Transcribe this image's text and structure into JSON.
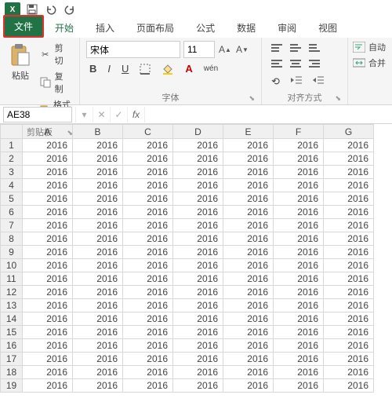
{
  "titlebar": {
    "app": "X",
    "qat": {
      "save": "",
      "undo": "",
      "redo": ""
    }
  },
  "tabs": {
    "file": "文件",
    "items": [
      "开始",
      "插入",
      "页面布局",
      "公式",
      "数据",
      "审阅",
      "视图"
    ],
    "activeIndex": 0
  },
  "ribbon": {
    "clipboard": {
      "label": "剪贴板",
      "paste": "粘贴",
      "cut": "剪切",
      "copy": "复制",
      "format_painter": "格式刷"
    },
    "font": {
      "label": "字体",
      "name": "宋体",
      "size": "11",
      "bold": "B",
      "italic": "I",
      "underline": "U",
      "wen": "wén"
    },
    "alignment": {
      "label": "对齐方式"
    },
    "extra": {
      "wrap": "自动",
      "merge": "合并"
    }
  },
  "formula_bar": {
    "namebox": "AE38",
    "cancel": "✕",
    "enter": "✓",
    "fx": "fx",
    "value": ""
  },
  "sheet": {
    "columns": [
      "A",
      "B",
      "C",
      "D",
      "E",
      "F",
      "G"
    ],
    "row_count": 19,
    "cell_value": "2016"
  }
}
